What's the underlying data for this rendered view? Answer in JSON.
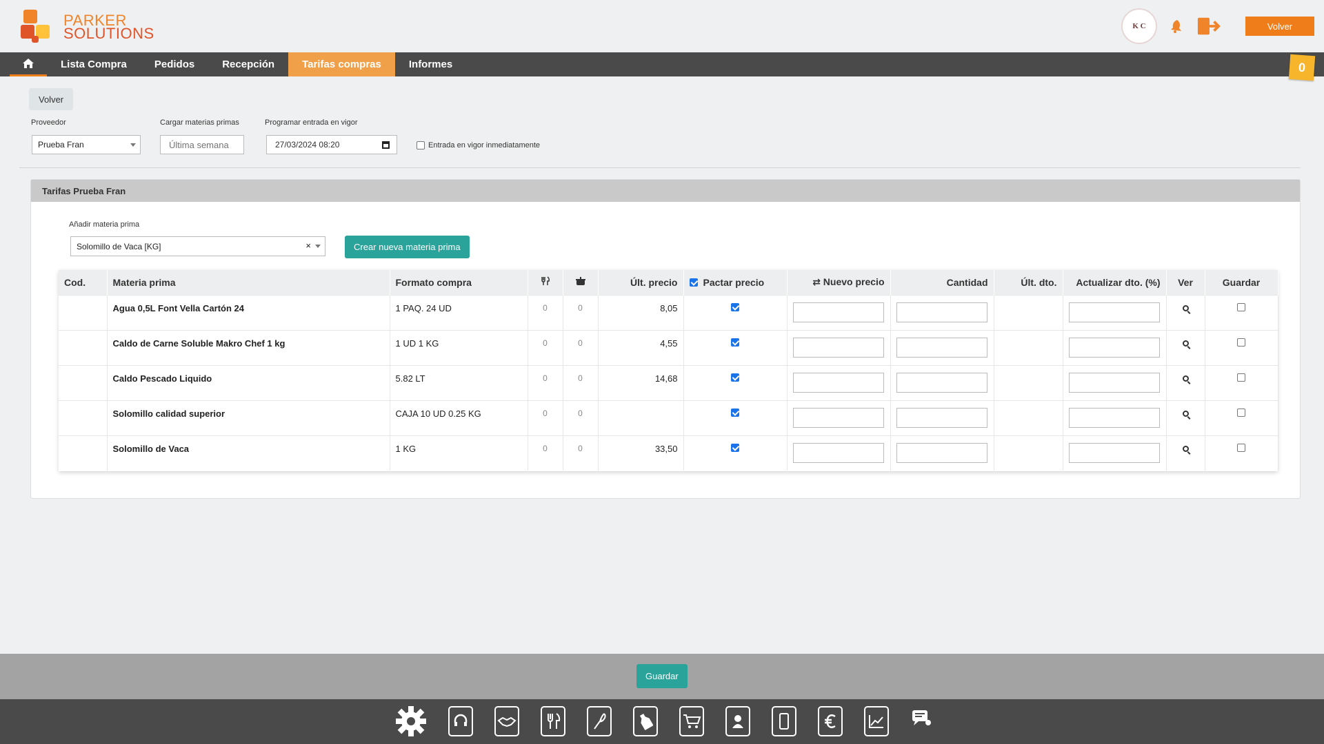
{
  "brand": {
    "line1": "PARKER",
    "line2": "SOLUTIONS",
    "colors": [
      "#f0842b",
      "#e0542a",
      "#ffc23a"
    ]
  },
  "header": {
    "avatar_text": "K C",
    "volver_label": "Volver",
    "icons": [
      "notification-icon",
      "logout-icon"
    ]
  },
  "nav": {
    "home_icon": "home-icon",
    "items": [
      {
        "label": "Lista Compra",
        "active": false
      },
      {
        "label": "Pedidos",
        "active": false
      },
      {
        "label": "Recepción",
        "active": false
      },
      {
        "label": "Tarifas compras",
        "active": true
      },
      {
        "label": "Informes",
        "active": false
      }
    ],
    "badge_count": "0"
  },
  "form": {
    "back_label": "Volver",
    "proveedor_label": "Proveedor",
    "proveedor_value": "Prueba Fran",
    "cargar_label": "Cargar materias primas",
    "cargar_value": "Última semana",
    "programar_label": "Programar entrada en vigor",
    "programar_value": "27/03/2024 08:20",
    "entrada_label": "Entrada en vigor inmediatamente"
  },
  "panel": {
    "title": "Tarifas Prueba Fran",
    "add_label": "Añadir materia prima",
    "add_value": "Solomillo de Vaca [KG]",
    "clear_icon": "×",
    "create_label": "Crear nueva materia prima"
  },
  "table": {
    "headers": {
      "cod": "Cod.",
      "materia": "Materia prima",
      "formato": "Formato compra",
      "fork_icon": "cutlery-icon",
      "pot_icon": "pot-icon",
      "ult_precio": "Últ. precio",
      "pactar": "Pactar precio",
      "nuevo": "⇄ Nuevo precio",
      "cantidad": "Cantidad",
      "ult_dto": "Últ. dto.",
      "actualizar": "Actualizar dto. (%)",
      "ver": "Ver",
      "guardar": "Guardar"
    },
    "rows": [
      {
        "cod": "",
        "materia": "Agua 0,5L Font Vella Cartón 24",
        "formato": "1 PAQ. 24 UD",
        "n1": "0",
        "n2": "0",
        "ult_precio": "8,05"
      },
      {
        "cod": "",
        "materia": "Caldo de Carne Soluble Makro Chef 1 kg",
        "formato": "1 UD 1 KG",
        "n1": "0",
        "n2": "0",
        "ult_precio": "4,55"
      },
      {
        "cod": "",
        "materia": "Caldo Pescado Liquido",
        "formato": "5.82 LT",
        "n1": "0",
        "n2": "0",
        "ult_precio": "14,68"
      },
      {
        "cod": "",
        "materia": "Solomillo calidad superior",
        "formato": "CAJA 10 UD 0.25 KG",
        "n1": "0",
        "n2": "0",
        "ult_precio": ""
      },
      {
        "cod": "",
        "materia": "Solomillo de Vaca",
        "formato": "1 KG",
        "n1": "0",
        "n2": "0",
        "ult_precio": "33,50"
      }
    ]
  },
  "footer": {
    "save_label": "Guardar",
    "dock_icons": [
      "settings-icon",
      "headset-icon",
      "handshake-icon",
      "cutlery-icon",
      "whisk-icon",
      "bottle-icon",
      "cart-icon",
      "contact-icon",
      "phone-icon",
      "euro-icon",
      "chart-icon",
      "chat-icon"
    ]
  }
}
